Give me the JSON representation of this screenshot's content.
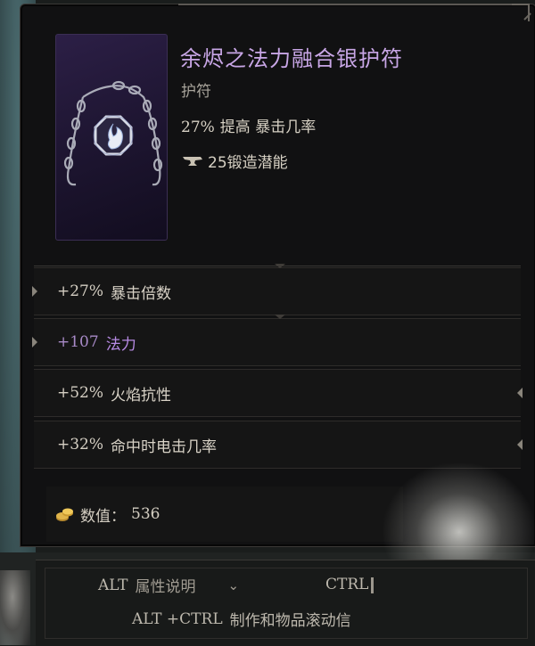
{
  "item": {
    "name": "余烬之法力融合银护符",
    "type": "护符",
    "implicit": {
      "value": "27%",
      "text": "提高 暴击几率"
    },
    "forging_potential": {
      "value": "25",
      "text": "锻造潜能"
    }
  },
  "affixes": [
    {
      "value": "+27%",
      "name": "暴击倍数",
      "tier": "normal"
    },
    {
      "value": "+107",
      "name": "法力",
      "tier": "purple"
    },
    {
      "value": "+52%",
      "name": "火焰抗性",
      "tier": "normal"
    },
    {
      "value": "+32%",
      "name": "命中时电击几率",
      "tier": "normal"
    }
  ],
  "value_box": {
    "label": "数值：",
    "amount": "536"
  },
  "hints": {
    "alt_key": "ALT",
    "alt_text": "属性说明",
    "chevron": "⌄",
    "ctrl_key": "CTRL",
    "alt_ctrl_key": "ALT +CTRL",
    "alt_ctrl_text": "制作和物品滚动信"
  },
  "colors": {
    "title": "#c8a6e6",
    "purple_affix": "#b68ae3",
    "panel_bg": "#111112"
  },
  "icons": {
    "item_art": "amulet-chain-flame-icon",
    "forging": "anvil-icon",
    "value": "gold-coins-icon"
  }
}
